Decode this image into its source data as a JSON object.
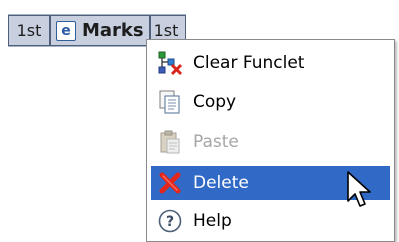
{
  "funclet": {
    "left_ordinal": "1st",
    "icon_letter": "e",
    "label": "Marks",
    "right_ordinal": "1st"
  },
  "context_menu": {
    "items": [
      {
        "label": "Clear Funclet",
        "icon": "clear-funclet-icon",
        "state": "normal"
      },
      {
        "label": "Copy",
        "icon": "copy-icon",
        "state": "normal"
      },
      {
        "label": "Paste",
        "icon": "paste-icon",
        "state": "disabled"
      },
      {
        "label": "Delete",
        "icon": "delete-icon",
        "state": "highlighted"
      },
      {
        "label": "Help",
        "icon": "help-icon",
        "state": "normal"
      }
    ]
  },
  "colors": {
    "highlight": "#3169c6",
    "funclet_bg": "#c8d0e0",
    "disabled_text": "#a6a6a6"
  }
}
